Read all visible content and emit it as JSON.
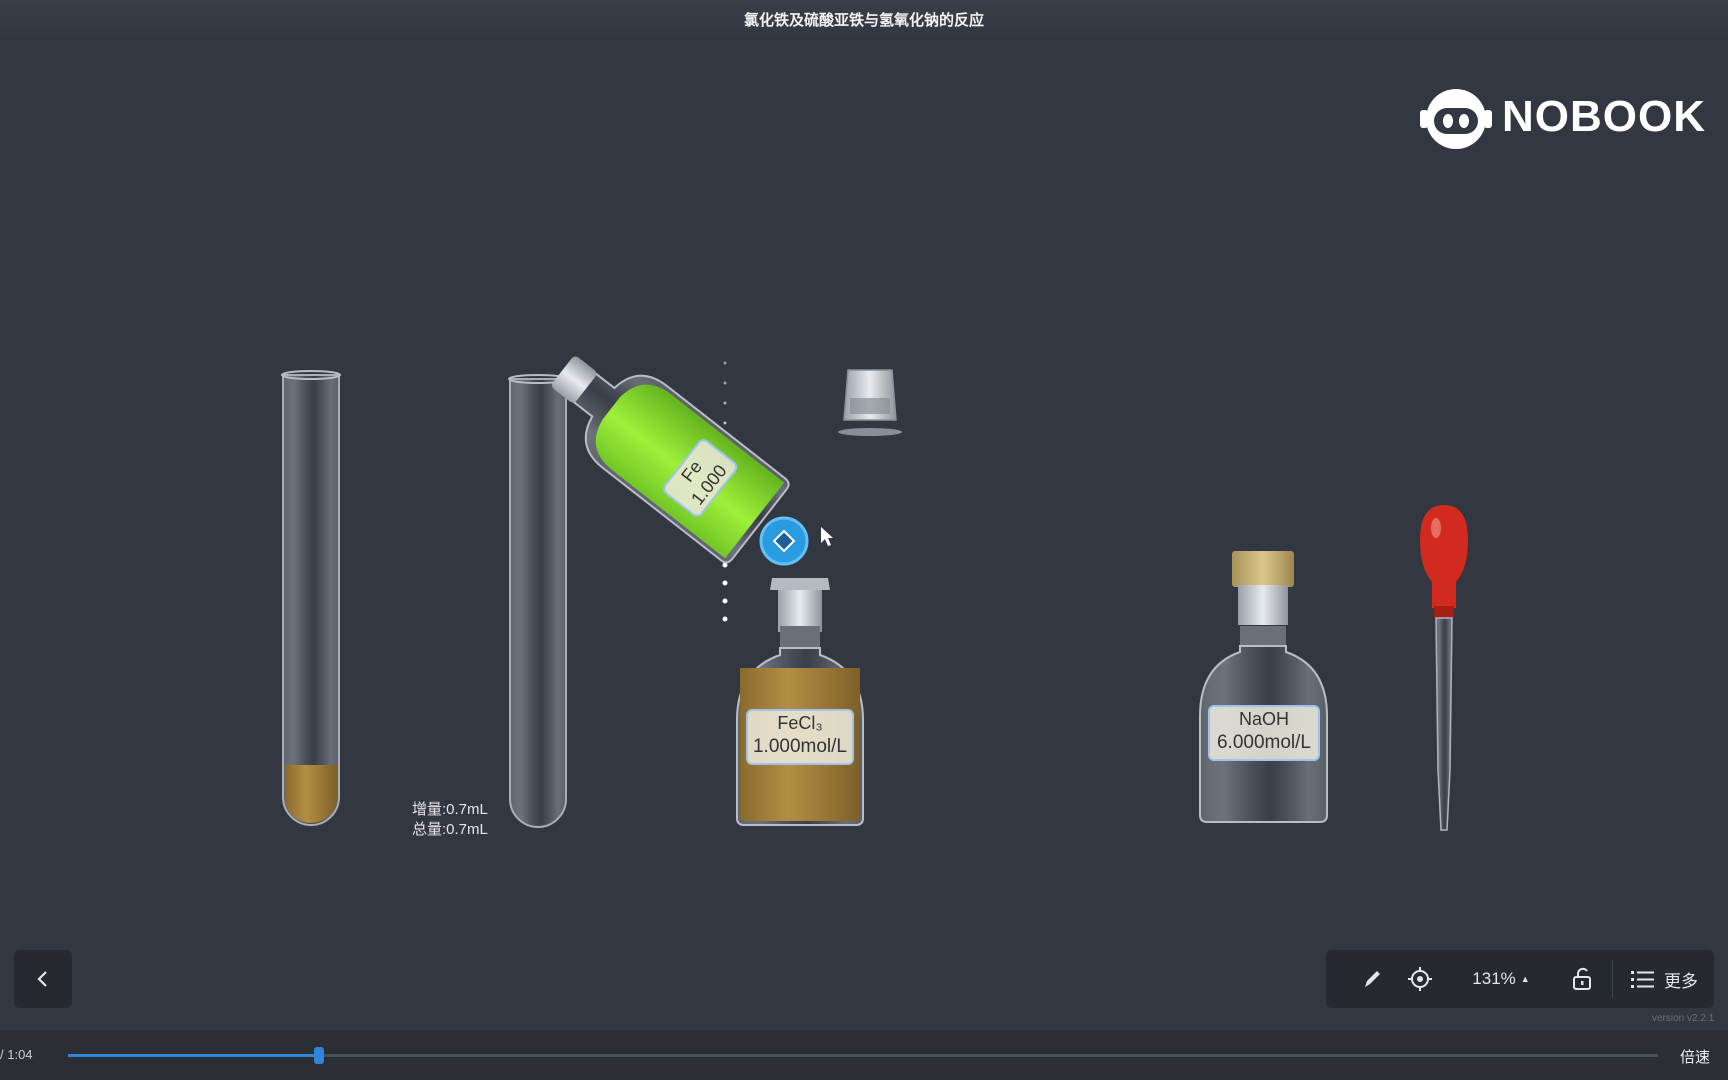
{
  "window": {
    "title": "氯化铁及硫酸亚铁与氢氧化钠的反应"
  },
  "brand": {
    "name": "NOBOOK"
  },
  "apparatus": {
    "tilted_bottle": {
      "line1": "Fe",
      "line2": "1.000"
    },
    "fecl3_bottle": {
      "formula": "FeCl₃",
      "concentration": "1.000mol/L"
    },
    "naoh_bottle": {
      "formula": "NaOH",
      "concentration": "6.000mol/L"
    },
    "readout": {
      "increment": "增量:0.7mL",
      "total": "总量:0.7mL"
    }
  },
  "toolbar": {
    "zoom": "131%",
    "more_label": "更多"
  },
  "version": "version v2.2.1",
  "player": {
    "time": "/ 1:04",
    "speed_label": "倍速",
    "progress_fraction": 0.158
  },
  "colors": {
    "background": "#333741",
    "green_solution": "#8ee02e",
    "brown_solution": "#a6823a",
    "dropper_bulb": "#d22a1f",
    "accent": "#2f86d8"
  }
}
